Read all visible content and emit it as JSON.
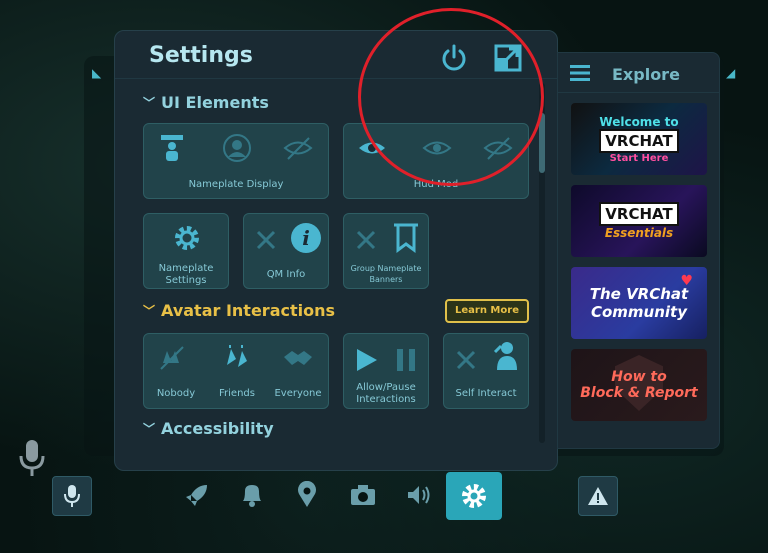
{
  "settings": {
    "title": "Settings",
    "sections": {
      "ui_elements": "UI Elements",
      "avatar_interactions": "Avatar Interactions",
      "accessibility": "Accessibility"
    },
    "tiles": {
      "nameplate_display": "Nameplate Display",
      "hud": "Hud Mod",
      "nameplate_settings": "Nameplate Settings",
      "qm_info": "QM Info",
      "group_banners": "Group Nameplate Banners",
      "nobody": "Nobody",
      "friends": "Friends",
      "everyone": "Everyone",
      "allow_pause": "Allow/Pause Interactions",
      "self_interact": "Self Interact"
    },
    "learn_more": "Learn More"
  },
  "explore": {
    "title": "Explore",
    "cards": [
      {
        "top": "Welcome to",
        "logo": "VRCHAT",
        "bottom": "Start Here"
      },
      {
        "logo": "VRCHAT",
        "bottom": "Essentials"
      },
      {
        "line1": "The VRChat",
        "line2": "Community"
      },
      {
        "line1": "How to",
        "line2": "Block & Report"
      }
    ]
  },
  "colors": {
    "accent": "#2aa6b8",
    "gold": "#e8c047",
    "annotation": "#e0202a"
  }
}
